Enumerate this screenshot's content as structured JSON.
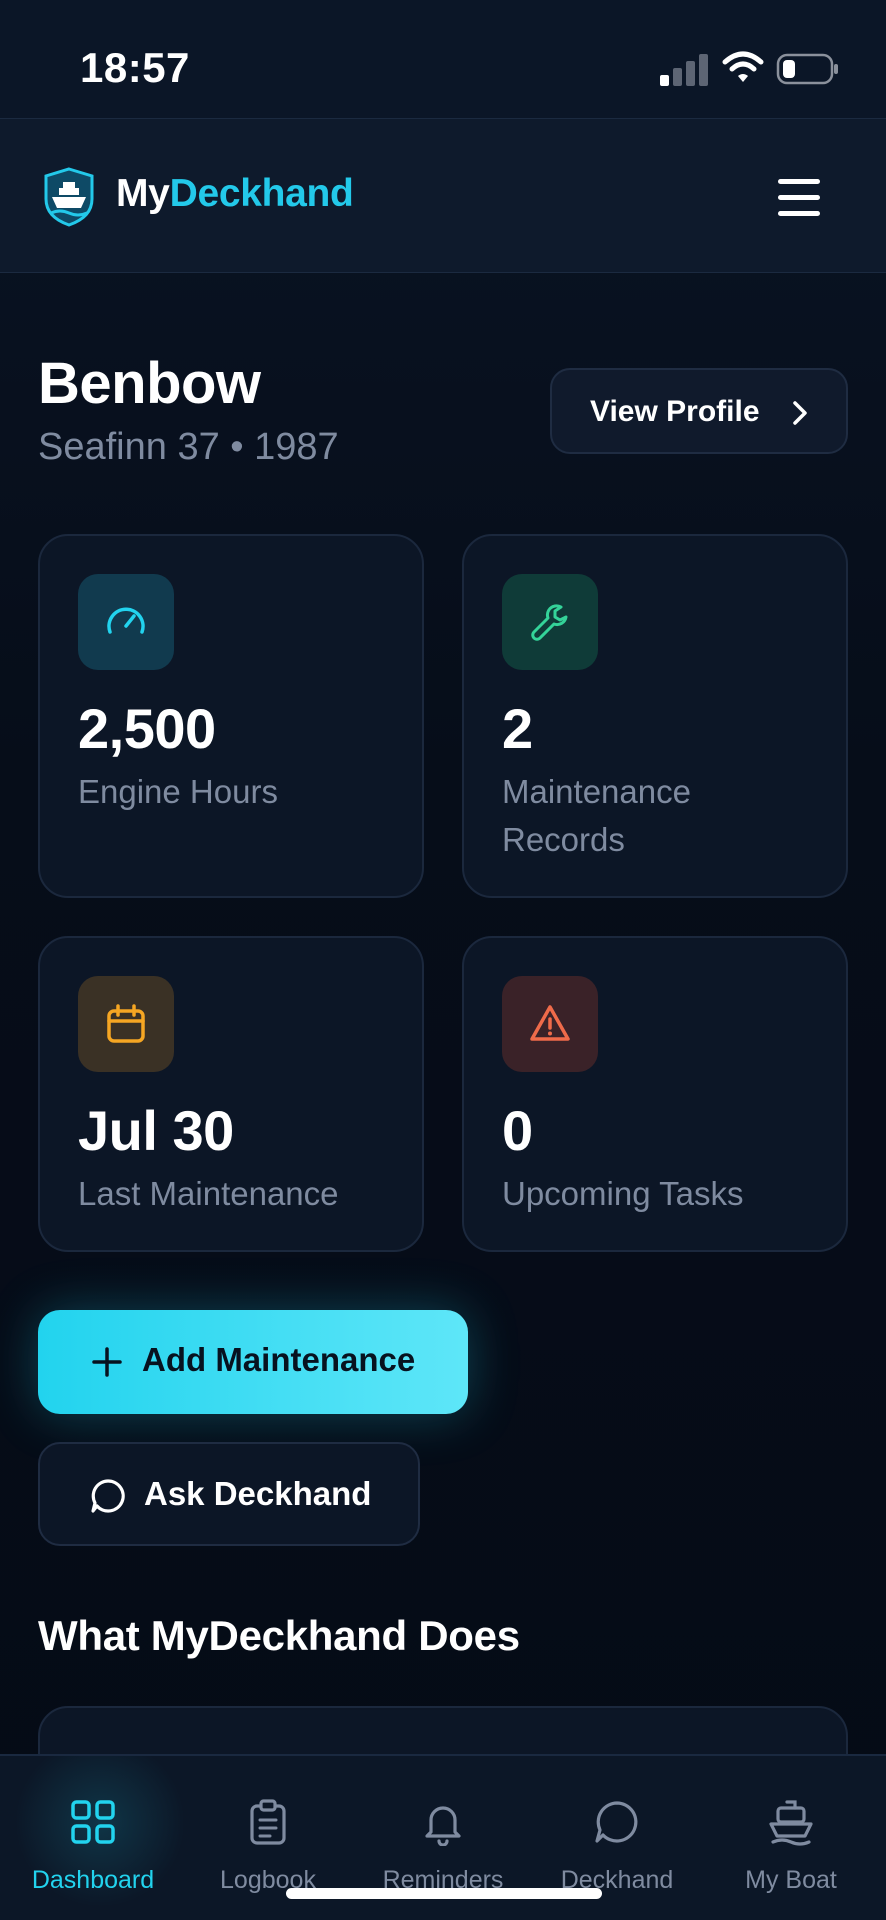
{
  "status_bar": {
    "time": "18:57"
  },
  "header": {
    "brand_part1": "My",
    "brand_part2": "Deckhand"
  },
  "boat": {
    "name": "Benbow",
    "subtitle": "Seafinn 37 • 1987",
    "view_profile_label": "View Profile"
  },
  "stats": [
    {
      "value": "2,500",
      "label": "Engine Hours",
      "icon": "gauge-icon",
      "color": "#22d3ee"
    },
    {
      "value": "2",
      "label": "Maintenance Records",
      "icon": "wrench-icon",
      "color": "#34d399"
    },
    {
      "value": "Jul 30",
      "label": "Last Maintenance",
      "icon": "calendar-icon",
      "color": "#f5a623"
    },
    {
      "value": "0",
      "label": "Upcoming Tasks",
      "icon": "warning-icon",
      "color": "#ef6b4a"
    }
  ],
  "actions": {
    "add_maintenance": "Add Maintenance",
    "ask_deckhand": "Ask Deckhand"
  },
  "section": {
    "title": "What MyDeckhand Does"
  },
  "nav": [
    {
      "label": "Dashboard",
      "icon": "dashboard-icon",
      "active": true
    },
    {
      "label": "Logbook",
      "icon": "clipboard-icon",
      "active": false
    },
    {
      "label": "Reminders",
      "icon": "bell-icon",
      "active": false
    },
    {
      "label": "Deckhand",
      "icon": "chat-icon",
      "active": false
    },
    {
      "label": "My Boat",
      "icon": "boat-icon",
      "active": false
    }
  ],
  "colors": {
    "accent": "#22d3ee",
    "background": "#060d19",
    "muted_text": "#7f8ba0"
  }
}
